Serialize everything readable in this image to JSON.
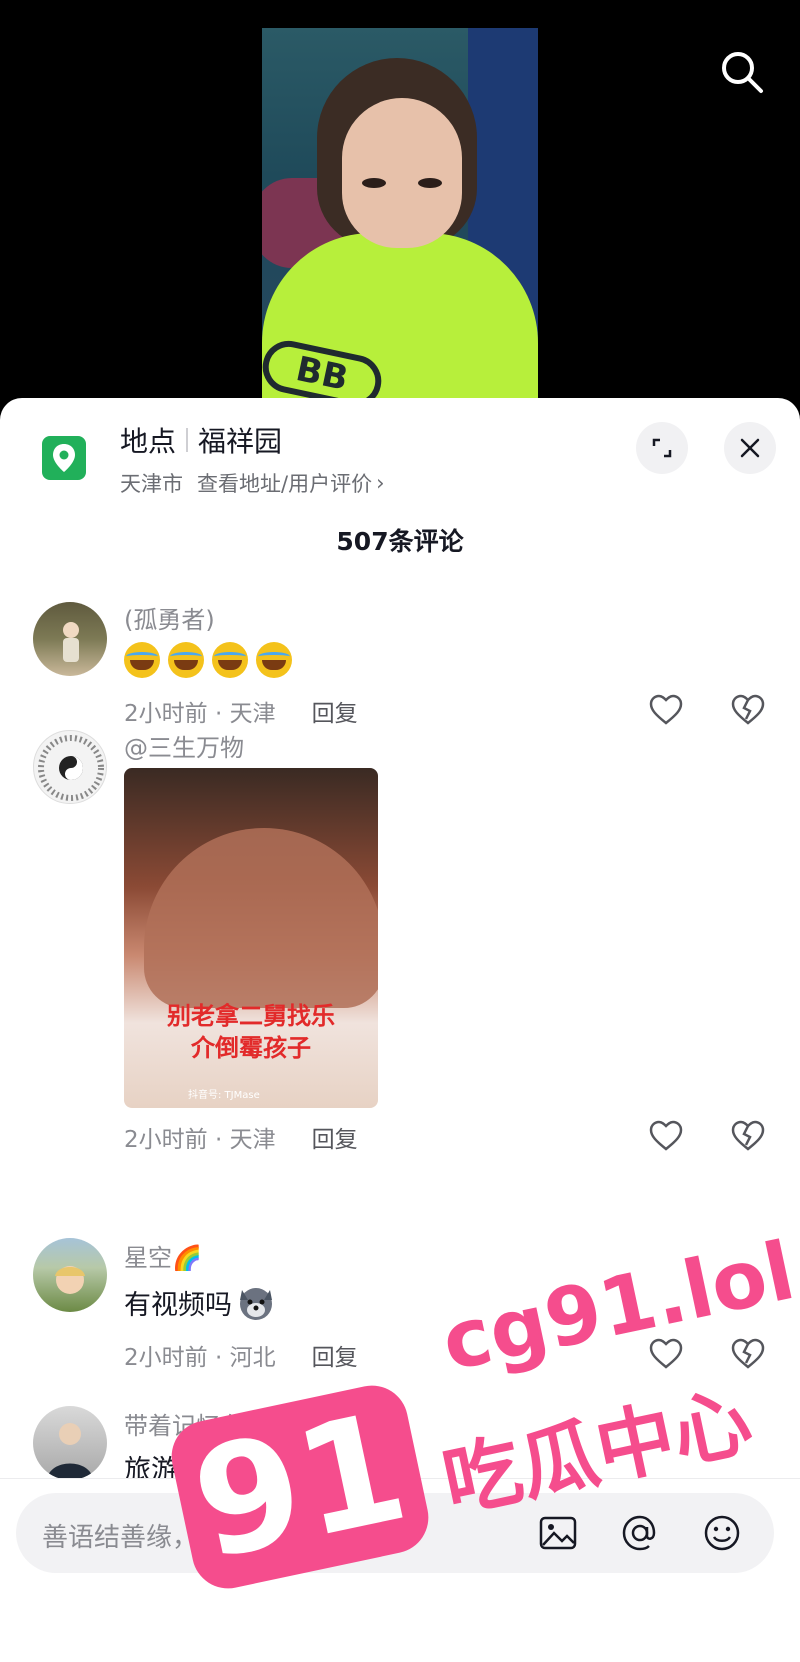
{
  "location": {
    "label": "地点",
    "name": "福祥园",
    "city": "天津市",
    "link": "查看地址/用户评价",
    "link_chevron": "›"
  },
  "comments_header": "507条评论",
  "comments": [
    {
      "user": "(孤勇者)",
      "emoji_count": 4,
      "emoji_name": "laughing-crying",
      "time": "2小时前 · 天津",
      "reply": "回复"
    },
    {
      "user": "@三生万物",
      "attachment_caption_1": "别老拿二舅找乐",
      "attachment_caption_2": "介倒霉孩子",
      "attachment_watermark": "抖音号: TJMase",
      "time": "2小时前 · 天津",
      "reply": "回复"
    },
    {
      "user": "星空🌈",
      "text": "有视频吗",
      "emoji_name": "dog-face",
      "time": "2小时前 · 河北",
      "reply": "回复"
    },
    {
      "user": "带着记忆在轮回中找到你",
      "text": "旅游还没回来"
    }
  ],
  "input": {
    "placeholder": "善语结善缘，恶言伤人心"
  },
  "watermark": {
    "badge": "91",
    "url": "cg91.lol",
    "name": "吃瓜中心"
  },
  "colors": {
    "accent_green": "#21b05a",
    "watermark_pink": "#f54d8d",
    "text_primary": "#161823",
    "text_secondary": "#8a8b91"
  }
}
